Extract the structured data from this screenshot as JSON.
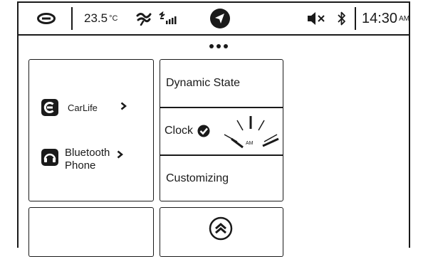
{
  "status_bar": {
    "temperature": "23.5",
    "temperature_unit": "°C",
    "time": "14:30",
    "time_suffix": "AM",
    "icons": [
      "brand-logo-icon",
      "wind-icon",
      "signal-icon",
      "navigation-icon",
      "mute-icon",
      "bluetooth-icon"
    ]
  },
  "page_indicator": {
    "count": 3
  },
  "left_tile": {
    "items": [
      {
        "label": "CarLife",
        "icon": "carlife-icon"
      },
      {
        "label_line1": "Bluetooth",
        "label_line2": "Phone",
        "icon": "phone-icon"
      }
    ]
  },
  "menu": {
    "items": [
      {
        "label": "Dynamic State"
      },
      {
        "label": "Clock",
        "clock_label": "AM"
      },
      {
        "label": "Customizing"
      }
    ]
  },
  "colors": {
    "foreground": "#1a1a1a",
    "background": "#ffffff"
  }
}
